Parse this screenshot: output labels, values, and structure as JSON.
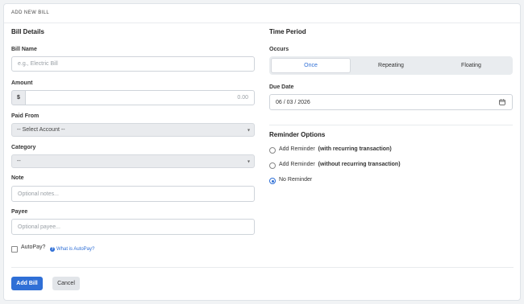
{
  "header": {
    "title": "ADD NEW BILL"
  },
  "bill_details": {
    "title": "Bill Details",
    "bill_name": {
      "label": "Bill Name",
      "placeholder": "e.g., Electric Bill"
    },
    "amount": {
      "label": "Amount",
      "currency": "$",
      "placeholder": "0.00"
    },
    "paid_from": {
      "label": "Paid From",
      "selected": "-- Select Account --"
    },
    "category": {
      "label": "Category",
      "selected": "--"
    },
    "note": {
      "label": "Note",
      "placeholder": "Optional notes..."
    },
    "payee": {
      "label": "Payee",
      "placeholder": "Optional payee..."
    },
    "autopay": {
      "label": "AutoPay?",
      "checked": false,
      "help_link": "What is AutoPay?"
    }
  },
  "time_period": {
    "title": "Time Period",
    "occurs": {
      "label": "Occurs",
      "options": [
        "Once",
        "Repeating",
        "Floating"
      ],
      "selected": "Once"
    },
    "due_date": {
      "label": "Due Date",
      "value": "06 / 03 / 2026"
    }
  },
  "reminder_options": {
    "title": "Reminder Options",
    "options": [
      {
        "label": "Add Reminder",
        "detail": "(with recurring transaction)",
        "checked": false
      },
      {
        "label": "Add Reminder",
        "detail": "(without recurring transaction)",
        "checked": false
      },
      {
        "label": "No Reminder",
        "detail": "",
        "checked": true
      }
    ]
  },
  "actions": {
    "add_label": "Add Bill",
    "cancel_label": "Cancel"
  },
  "icons": {
    "calendar": "calendar-icon",
    "help": "question-circle-icon",
    "chevron": "chevron-down-icon"
  },
  "colors": {
    "accent": "#2f6fd6",
    "background": "#f1f3f5",
    "select_bg": "#e9ebee"
  }
}
